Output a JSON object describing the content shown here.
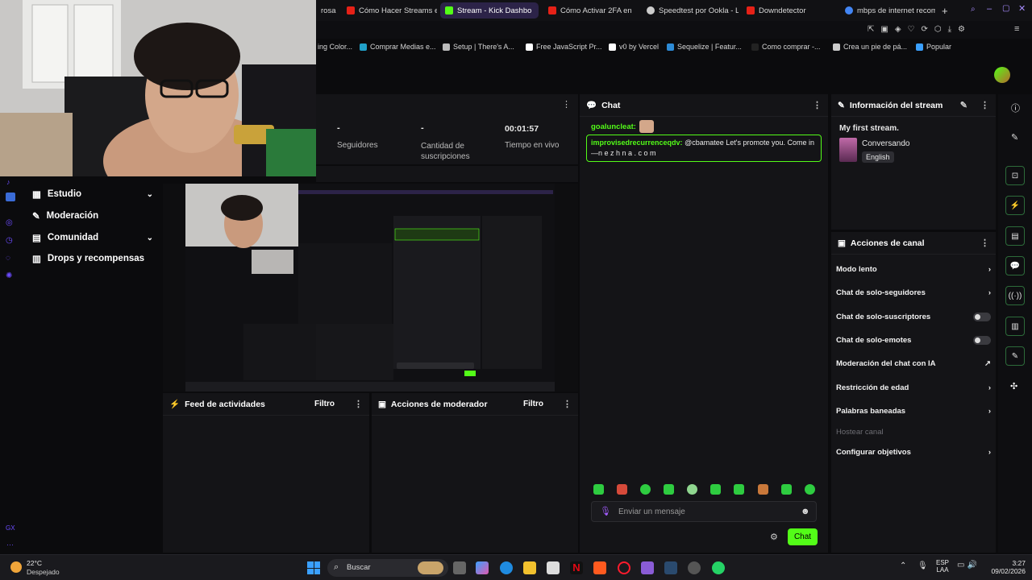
{
  "browser": {
    "tabs": [
      {
        "label": "rosa",
        "color": "#777"
      },
      {
        "label": "Cómo Hacer Streams en",
        "color": "#e62117"
      },
      {
        "label": "Stream - Kick Dashbo",
        "color": "#53fc18",
        "active": true
      },
      {
        "label": "Cómo Activar 2FA en",
        "color": "#e62117"
      },
      {
        "label": "Speedtest por Ookla - La",
        "color": "#ccc"
      },
      {
        "label": "Downdetector",
        "color": "#e62117"
      },
      {
        "label": "mbps de internet recome",
        "color": "#4285f4"
      }
    ],
    "new_tab": "+",
    "bookmarks": [
      {
        "label": "ing Color...",
        "color": "#888"
      },
      {
        "label": "Comprar Medias e...",
        "color": "#21a0c8"
      },
      {
        "label": "Setup | There's A...",
        "color": "#bbb"
      },
      {
        "label": "Free JavaScript Pr...",
        "color": "#fff"
      },
      {
        "label": "v0 by Vercel",
        "color": "#fff"
      },
      {
        "label": "Sequelize | Featur...",
        "color": "#2d8bd6"
      },
      {
        "label": "Como comprar -...",
        "color": "#222"
      },
      {
        "label": "Crea un pie de pá...",
        "color": "#ccc"
      },
      {
        "label": "Popular",
        "color": "#3aa0ff"
      }
    ]
  },
  "stats": {
    "seguidores_value": "-",
    "seguidores_label": "Seguidores",
    "subs_value": "-",
    "subs_label": "Cantidad de suscripciones",
    "uptime_value": "00:01:57",
    "uptime_label": "Tiempo en vivo"
  },
  "sidebar": {
    "items": [
      {
        "label": "Estudio",
        "chevron": true
      },
      {
        "label": "Moderación",
        "chevron": false
      },
      {
        "label": "Comunidad",
        "chevron": true
      },
      {
        "label": "Drops y recompensas",
        "chevron": false
      }
    ]
  },
  "chat": {
    "title": "Chat",
    "messages": [
      {
        "user": "goaluncleat:",
        "text": ""
      },
      {
        "user": "improvisedrecurrenceqdv:",
        "text": "@cbamatee Let's promote you. Come in —n e z h n a . c o m"
      }
    ],
    "input_placeholder": "Enviar un mensaje",
    "send_label": "Chat"
  },
  "stream_info": {
    "title": "Información del stream",
    "stream_title": "My first stream.",
    "category": "Conversando",
    "language": "English"
  },
  "channel_actions": {
    "title": "Acciones de canal",
    "items": [
      {
        "label": "Modo lento",
        "control": "chevron"
      },
      {
        "label": "Chat de solo-seguidores",
        "control": "chevron"
      },
      {
        "label": "Chat de solo-suscriptores",
        "control": "toggle"
      },
      {
        "label": "Chat de solo-emotes",
        "control": "toggle"
      },
      {
        "label": "Moderación del chat con IA",
        "control": "external"
      },
      {
        "label": "Restricción de edad",
        "control": "chevron"
      },
      {
        "label": "Palabras baneadas",
        "control": "chevron"
      },
      {
        "label": "Hostear canal",
        "control": "none",
        "disabled": true
      },
      {
        "label": "Configurar objetivos",
        "control": "chevron"
      }
    ]
  },
  "activity_feed": {
    "title": "Feed de actividades",
    "filter": "Filtro"
  },
  "mod_actions": {
    "title": "Acciones de moderador",
    "filter": "Filtro"
  },
  "taskbar": {
    "weather_temp": "22°C",
    "weather_desc": "Despejado",
    "search_label": "Buscar",
    "lang": "ESP",
    "region": "LAA",
    "time": "3:27",
    "date": "09/02/2026"
  },
  "colors": {
    "accent": "#53fc18",
    "panel": "#141417",
    "bg": "#0b0b0d"
  }
}
